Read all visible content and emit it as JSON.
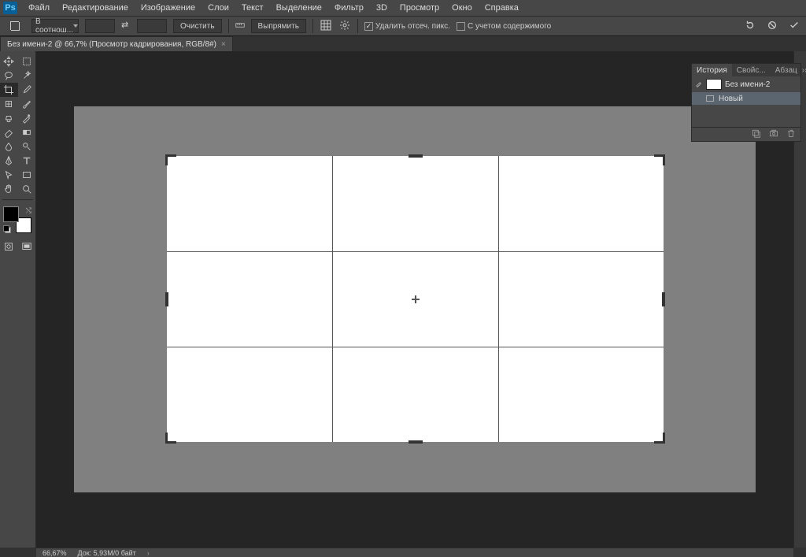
{
  "app_logo": "Ps",
  "menu": [
    "Файл",
    "Редактирование",
    "Изображение",
    "Слои",
    "Текст",
    "Выделение",
    "Фильтр",
    "3D",
    "Просмотр",
    "Окно",
    "Справка"
  ],
  "options": {
    "ratio_preset": "В соотнош...",
    "clear_btn": "Очистить",
    "straighten_btn": "Выпрямить",
    "delete_px_label": "Удалить отсеч. пикс.",
    "content_aware_label": "С учетом содержимого"
  },
  "tab": {
    "title": "Без имени-2 @ 66,7% (Просмотр кадрирования, RGB/8#)"
  },
  "history_panel": {
    "tabs": [
      "История",
      "Свойс...",
      "Абзац"
    ],
    "doc_name": "Без имени-2",
    "step1": "Новый"
  },
  "status": {
    "zoom": "66,67%",
    "docinfo": "Док: 5,93M/0 байт"
  },
  "colors": {
    "fg": "#000000",
    "bg": "#ffffff"
  }
}
